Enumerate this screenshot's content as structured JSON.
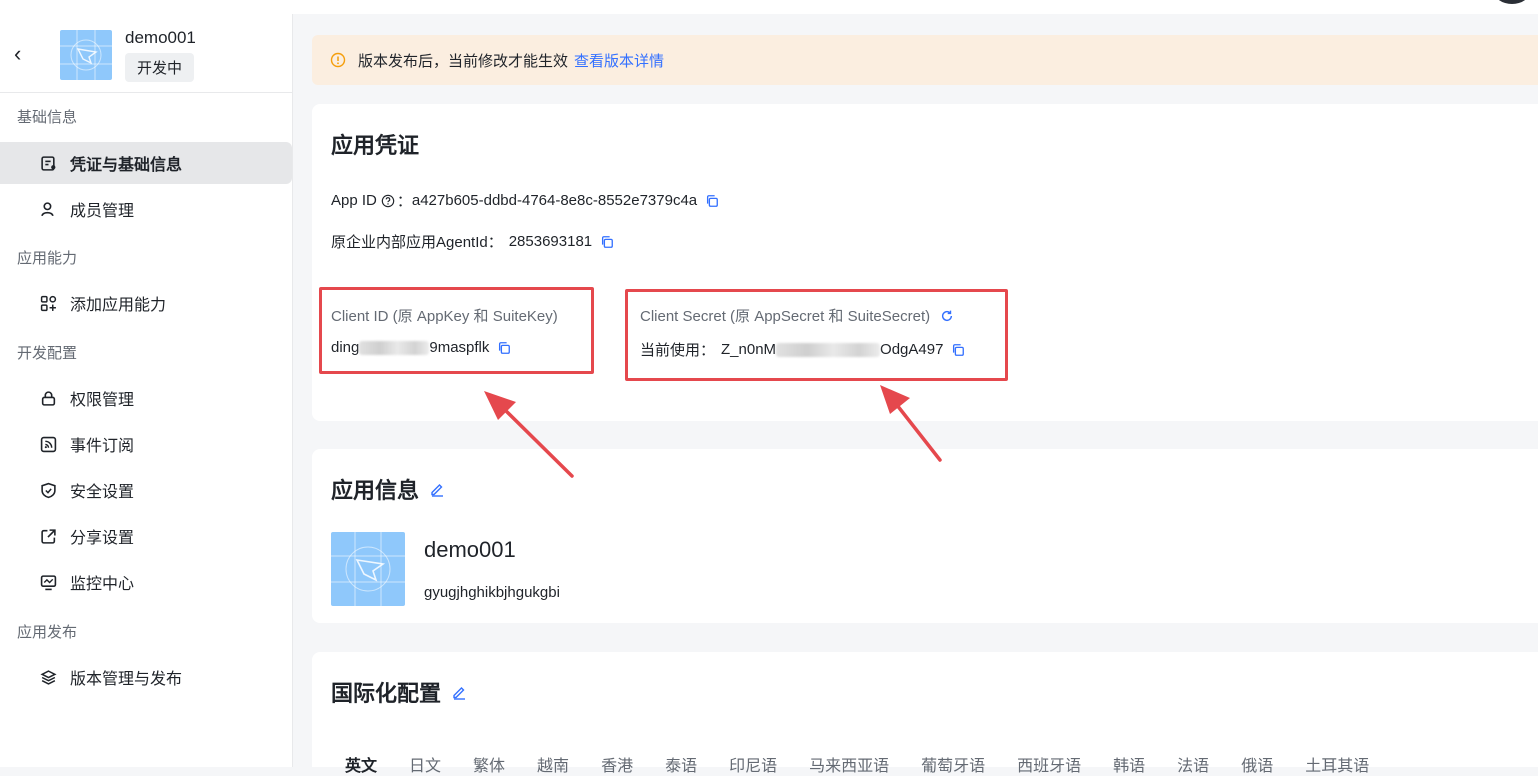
{
  "app": {
    "name": "demo001",
    "status": "开发中",
    "logo_color": "#8fc8fb"
  },
  "sidebar": {
    "groups": [
      {
        "label": "基础信息"
      },
      {
        "label": "应用能力"
      },
      {
        "label": "开发配置"
      },
      {
        "label": "应用发布"
      }
    ],
    "items": [
      {
        "label": "凭证与基础信息",
        "icon": "credential-icon",
        "active": true
      },
      {
        "label": "成员管理",
        "icon": "user-icon"
      },
      {
        "label": "添加应用能力",
        "icon": "grid-plus-icon"
      },
      {
        "label": "权限管理",
        "icon": "lock-icon"
      },
      {
        "label": "事件订阅",
        "icon": "rss-icon"
      },
      {
        "label": "安全设置",
        "icon": "shield-icon"
      },
      {
        "label": "分享设置",
        "icon": "share-icon"
      },
      {
        "label": "监控中心",
        "icon": "monitor-icon"
      },
      {
        "label": "版本管理与发布",
        "icon": "layers-icon"
      }
    ]
  },
  "notice": {
    "text": "版本发布后，当前修改才能生效",
    "link": "查看版本详情",
    "color": "#fbeee0"
  },
  "credentials": {
    "title": "应用凭证",
    "app_id_label": "App ID",
    "app_id_value": "a427b605-ddbd-4764-8e8c-8552e7379c4a",
    "agent_label": "原企业内部应用AgentId：",
    "agent_value": "2853693181",
    "client_id_label": "Client ID (原 AppKey 和 SuiteKey)",
    "client_id_prefix": "ding",
    "client_id_suffix": "9maspflk",
    "client_secret_label": "Client Secret (原 AppSecret 和 SuiteSecret)",
    "client_secret_current_label": "当前使用：",
    "client_secret_prefix": "Z_n0nM",
    "client_secret_suffix": "OdgA497",
    "highlight_color": "#e5484d"
  },
  "app_info": {
    "title": "应用信息",
    "name": "demo001",
    "desc": "gyugjhghikbjhgukgbi"
  },
  "i18n": {
    "title": "国际化配置",
    "tabs": [
      {
        "label": "英文",
        "active": true
      },
      {
        "label": "日文"
      },
      {
        "label": "繁体"
      },
      {
        "label": "越南"
      },
      {
        "label": "香港"
      },
      {
        "label": "泰语"
      },
      {
        "label": "印尼语"
      },
      {
        "label": "马来西亚语"
      },
      {
        "label": "葡萄牙语"
      },
      {
        "label": "西班牙语"
      },
      {
        "label": "韩语"
      },
      {
        "label": "法语"
      },
      {
        "label": "俄语"
      },
      {
        "label": "土耳其语"
      }
    ]
  },
  "colors": {
    "accent": "#3370ff",
    "sidebar_active": "#e6e7e9"
  }
}
